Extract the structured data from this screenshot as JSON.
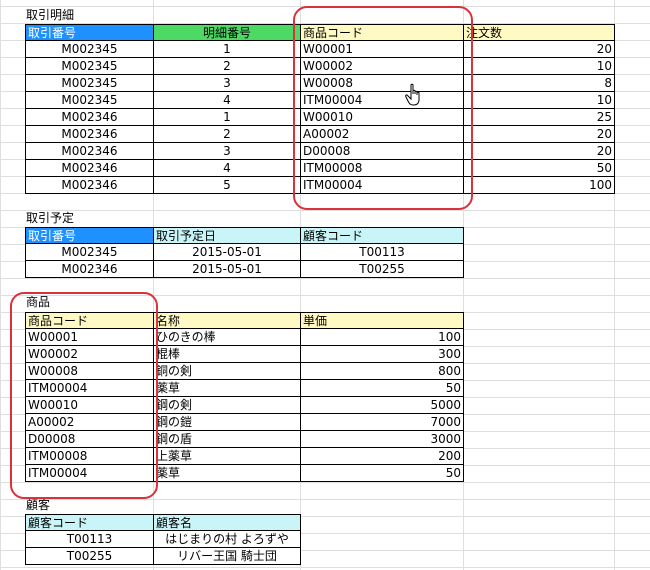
{
  "transactions": {
    "title": "取引明細",
    "headers": [
      "取引番号",
      "明細番号",
      "商品コード",
      "注文数"
    ],
    "rows": [
      [
        "M002345",
        "1",
        "W00001",
        "20"
      ],
      [
        "M002345",
        "2",
        "W00002",
        "10"
      ],
      [
        "M002345",
        "3",
        "W00008",
        "8"
      ],
      [
        "M002345",
        "4",
        "ITM00004",
        "10"
      ],
      [
        "M002346",
        "1",
        "W00010",
        "25"
      ],
      [
        "M002346",
        "2",
        "A00002",
        "20"
      ],
      [
        "M002346",
        "3",
        "D00008",
        "20"
      ],
      [
        "M002346",
        "4",
        "ITM00008",
        "50"
      ],
      [
        "M002346",
        "5",
        "ITM00004",
        "100"
      ]
    ]
  },
  "schedule": {
    "title": "取引予定",
    "headers": [
      "取引番号",
      "取引予定日",
      "顧客コード"
    ],
    "rows": [
      [
        "M002345",
        "2015-05-01",
        "T00113"
      ],
      [
        "M002346",
        "2015-05-01",
        "T00255"
      ]
    ]
  },
  "products": {
    "title": "商品",
    "headers": [
      "商品コード",
      "名称",
      "単価"
    ],
    "rows": [
      [
        "W00001",
        "ひのきの棒",
        "100"
      ],
      [
        "W00002",
        "棍棒",
        "300"
      ],
      [
        "W00008",
        "銅の剣",
        "800"
      ],
      [
        "ITM00004",
        "薬草",
        "50"
      ],
      [
        "W00010",
        "鋼の剣",
        "5000"
      ],
      [
        "A00002",
        "鋼の鎧",
        "7000"
      ],
      [
        "D00008",
        "鋼の盾",
        "3000"
      ],
      [
        "ITM00008",
        "上薬草",
        "200"
      ],
      [
        "ITM00004",
        "薬草",
        "50"
      ]
    ]
  },
  "customers": {
    "title": "顧客",
    "headers": [
      "顧客コード",
      "顧客名"
    ],
    "rows": [
      [
        "T00113",
        "はじまりの村 よろずや"
      ],
      [
        "T00255",
        "リバー王国 騎士団"
      ]
    ]
  },
  "colors": {
    "header_blue": "#1e90ff",
    "header_green": "#4cd964",
    "header_yellow": "#fff9c4",
    "header_cyan": "#c9f5f8",
    "highlight_red": "#d9323a",
    "gridline": "#dedede"
  },
  "icons": {
    "cursor": "hand-pointer-icon"
  }
}
